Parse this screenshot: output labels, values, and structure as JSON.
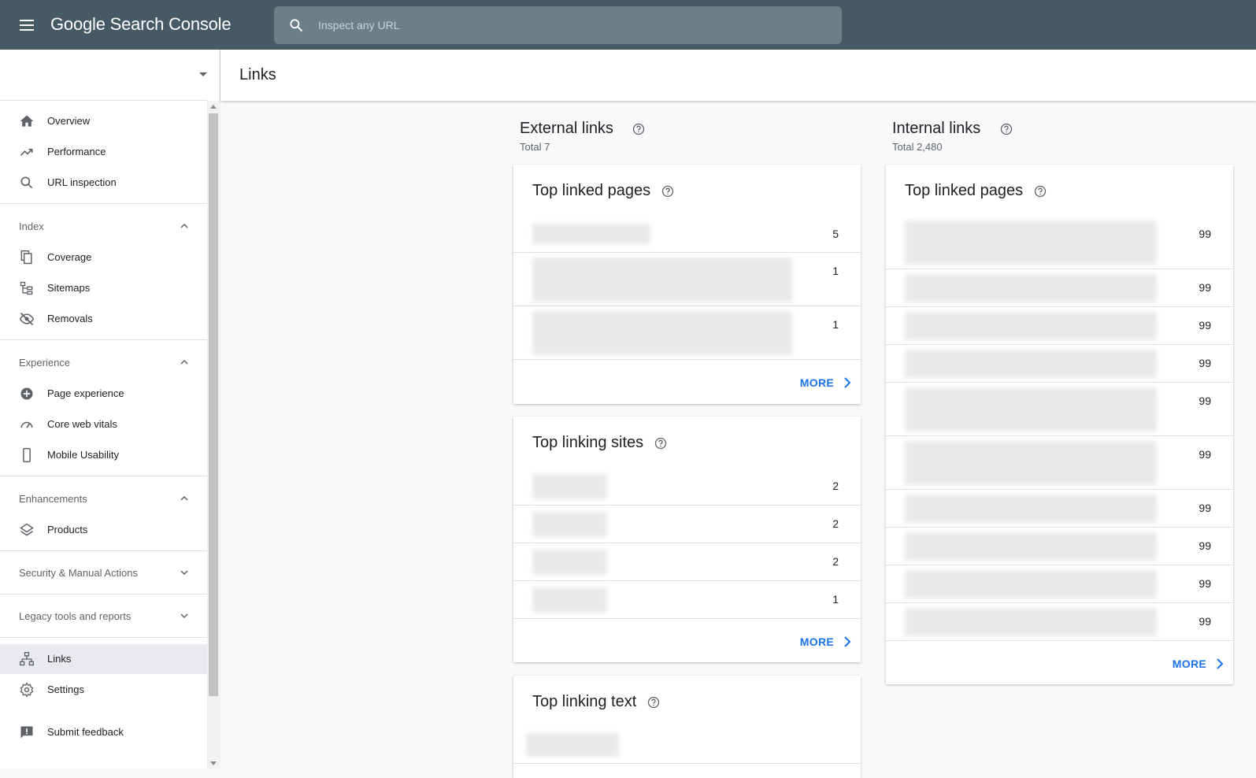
{
  "app": {
    "logo_google": "Google",
    "logo_product": "Search Console"
  },
  "search": {
    "placeholder": "Inspect any URL"
  },
  "property": {
    "value": ""
  },
  "sidebar": {
    "items_top": [
      {
        "label": "Overview",
        "icon": "home-icon"
      },
      {
        "label": "Performance",
        "icon": "trending-up-icon"
      },
      {
        "label": "URL inspection",
        "icon": "search-icon"
      }
    ],
    "index": {
      "header": "Index",
      "items": [
        {
          "label": "Coverage",
          "icon": "copy-icon"
        },
        {
          "label": "Sitemaps",
          "icon": "sitemap-icon"
        },
        {
          "label": "Removals",
          "icon": "visibility-off-icon"
        }
      ]
    },
    "experience": {
      "header": "Experience",
      "items": [
        {
          "label": "Page experience",
          "icon": "add-circle-icon"
        },
        {
          "label": "Core web vitals",
          "icon": "speed-gauge-icon"
        },
        {
          "label": "Mobile Usability",
          "icon": "smartphone-icon"
        }
      ]
    },
    "enhancements": {
      "header": "Enhancements",
      "items": [
        {
          "label": "Products",
          "icon": "layers-icon"
        }
      ]
    },
    "security": {
      "header": "Security & Manual Actions"
    },
    "legacy": {
      "header": "Legacy tools and reports"
    },
    "bottom": [
      {
        "label": "Links",
        "icon": "links-icon",
        "active": true
      },
      {
        "label": "Settings",
        "icon": "gear-icon"
      },
      {
        "label": "Submit feedback",
        "icon": "feedback-icon"
      }
    ]
  },
  "page": {
    "title": "Links"
  },
  "external": {
    "title": "External links",
    "total": "Total 7",
    "top_linked_pages": {
      "title": "Top linked pages",
      "values": [
        "5",
        "1",
        "1"
      ],
      "more": "MORE"
    },
    "top_linking_sites": {
      "title": "Top linking sites",
      "values": [
        "2",
        "2",
        "2",
        "1"
      ],
      "more": "MORE"
    },
    "top_linking_text": {
      "title": "Top linking text"
    }
  },
  "internal": {
    "title": "Internal links",
    "total": "Total 2,480",
    "top_linked_pages": {
      "title": "Top linked pages",
      "values": [
        "99",
        "99",
        "99",
        "99",
        "99",
        "99",
        "99",
        "99",
        "99",
        "99"
      ],
      "more": "MORE"
    }
  },
  "colors": {
    "topbar": "#455a64",
    "search_bg": "#6b7f89",
    "accent": "#1a73e8",
    "active_nav": "#e8eaed"
  }
}
